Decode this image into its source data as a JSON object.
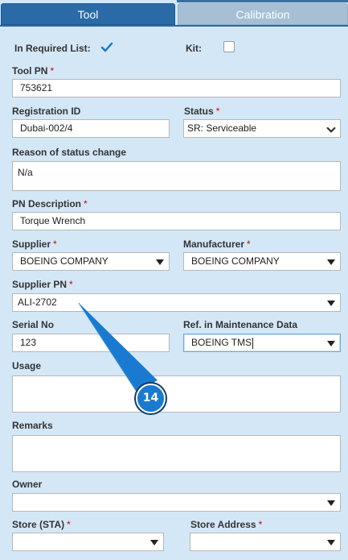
{
  "tabs": [
    {
      "label": "Tool",
      "active": true
    },
    {
      "label": "Calibration",
      "active": false
    }
  ],
  "required_list": {
    "label": "In Required List:",
    "checked": true
  },
  "kit": {
    "label": "Kit:",
    "checked": false
  },
  "tool_pn": {
    "label": "Tool PN",
    "value": "753621",
    "required": "*"
  },
  "registration_id": {
    "label": "Registration ID",
    "value": "Dubai-002/4"
  },
  "status": {
    "label": "Status",
    "value": "SR: Serviceable",
    "required": "*"
  },
  "reason": {
    "label": "Reason of status change",
    "value": "N/a"
  },
  "pn_description": {
    "label": "PN Description",
    "value": "Torque Wrench",
    "required": "*"
  },
  "supplier": {
    "label": "Supplier",
    "value": "BOEING COMPANY",
    "required": "*"
  },
  "manufacturer": {
    "label": "Manufacturer",
    "value": "BOEING COMPANY",
    "required": "*"
  },
  "supplier_pn": {
    "label": "Supplier PN",
    "value": "ALI-2702",
    "required": "*"
  },
  "serial_no": {
    "label": "Serial No",
    "value": "123"
  },
  "ref_maintenance": {
    "label": "Ref. in Maintenance Data",
    "value": "BOEING TMS"
  },
  "usage": {
    "label": "Usage",
    "value": ""
  },
  "remarks": {
    "label": "Remarks",
    "value": ""
  },
  "owner": {
    "label": "Owner",
    "value": ""
  },
  "store_sta": {
    "label": "Store (STA)",
    "value": "",
    "required": "*"
  },
  "store_address": {
    "label": "Store Address",
    "value": "",
    "required": "*"
  },
  "annotation": {
    "number": "14",
    "color": "#1a7ad0"
  },
  "colors": {
    "accent": "#2a6aa6",
    "background": "#d4e7f7",
    "required": "#d40000"
  }
}
